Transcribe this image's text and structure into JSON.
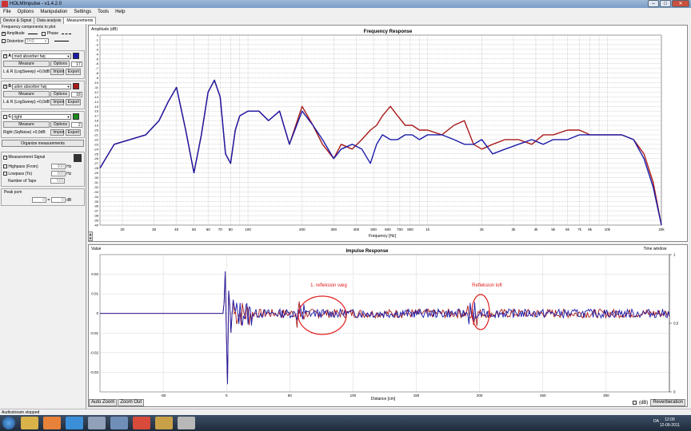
{
  "window": {
    "title": "HOLMImpulse - v1.4.2.0"
  },
  "menu": [
    "File",
    "Options",
    "Manipulation",
    "Settings",
    "Tools",
    "Help"
  ],
  "tabs": [
    {
      "label": "Device & Signal",
      "active": false
    },
    {
      "label": "Data analysis",
      "active": false
    },
    {
      "label": "Measurements",
      "active": true
    }
  ],
  "left": {
    "freq_components_label": "Frequency components to plot",
    "amplitude_label": "Amplitude",
    "phase_label": "Phase",
    "distortion_label": "Distortion",
    "distortion_value": "THD",
    "measurements": [
      {
        "letter": "A",
        "checked": true,
        "name": "med absorber høj",
        "color": "#1a1aa8",
        "measure_label": "Measure",
        "options_label": "Options",
        "spin": "17",
        "source": "L & R (LogSweep) +0,0dB",
        "import_label": "Import",
        "export_label": "Export"
      },
      {
        "letter": "B",
        "checked": true,
        "name": "uden absorber høj",
        "color": "#a81a1a",
        "measure_label": "Measure",
        "options_label": "Options",
        "spin": "18",
        "source": "L & R (LogSweep) +0,0dB",
        "import_label": "Import",
        "export_label": "Export"
      },
      {
        "letter": "C",
        "checked": false,
        "name": "right",
        "color": "#1a8a1a",
        "measure_label": "Measure",
        "options_label": "Options",
        "spin": "2",
        "source": "Right (SqNoise) +0,0dB",
        "import_label": "Import",
        "export_label": "Export"
      }
    ],
    "organize_label": "Organize measurements",
    "measurement_signal_label": "Measurement Signal",
    "highpass_label": "Highpass (From)",
    "highpass_value": "300",
    "lowpass_label": "Lowpass (To)",
    "lowpass_value": "500",
    "taps_label": "Number of Taps",
    "taps_value": "501",
    "hz": "Hz",
    "peak_label": "Peak pcm",
    "peak_db": "dB",
    "peak_sep": "=",
    "peak_value1": "0",
    "peak_value2": "0"
  },
  "chart_data": [
    {
      "type": "line",
      "title": "Frequency Response",
      "ylabel": "Amplitude (dB)",
      "xlabel": "Frequency [Hz]",
      "xscale": "log",
      "xlim": [
        15,
        20000
      ],
      "ylim": [
        -40,
        0
      ],
      "xticks": [
        20,
        30,
        40,
        50,
        60,
        70,
        80,
        100,
        200,
        300,
        400,
        500,
        600,
        700,
        800,
        "1k",
        "2k",
        "3k",
        "4k",
        "5k",
        "6k",
        "7k",
        "8k",
        "10k",
        "20k"
      ],
      "yticks": [
        0,
        -1,
        -2,
        -3,
        -4,
        -5,
        -6,
        -7,
        -8,
        -9,
        -10,
        -11,
        -12,
        -13,
        -14,
        -15,
        -16,
        -17,
        -18,
        -19,
        -20,
        -21,
        -22,
        -23,
        -24,
        -25,
        -26,
        -27,
        -28,
        -29,
        -30,
        -31,
        -32,
        -33,
        -34,
        -35,
        -36,
        -37,
        -38,
        -39,
        -40
      ],
      "series": [
        {
          "name": "med absorber høj",
          "color": "#1a1aa8",
          "x": [
            15,
            18,
            22,
            27,
            32,
            36,
            40,
            45,
            50,
            55,
            60,
            65,
            70,
            75,
            80,
            85,
            90,
            100,
            115,
            130,
            150,
            170,
            200,
            230,
            260,
            300,
            330,
            380,
            430,
            480,
            520,
            560,
            620,
            680,
            750,
            820,
            900,
            1000,
            1200,
            1400,
            1600,
            1800,
            2000,
            2300,
            2700,
            3200,
            3800,
            4400,
            5000,
            6000,
            7000,
            8000,
            9000,
            10000,
            12000,
            14000,
            16000,
            18000,
            20000
          ],
          "y": [
            -28,
            -23,
            -22,
            -21,
            -18,
            -14,
            -11,
            -20,
            -29,
            -21,
            -12,
            -9.5,
            -13,
            -25,
            -27,
            -20,
            -17,
            -16,
            -16,
            -18,
            -16,
            -23,
            -16,
            -19,
            -22,
            -26,
            -24,
            -23,
            -24,
            -27,
            -23,
            -21,
            -22,
            -22,
            -21,
            -21,
            -22,
            -21,
            -21,
            -22,
            -23,
            -23,
            -22,
            -25,
            -24,
            -23,
            -22,
            -23,
            -22,
            -22,
            -21,
            -21,
            -21,
            -21,
            -21,
            -22,
            -26,
            -32,
            -40
          ]
        },
        {
          "name": "uden absorber høj",
          "color": "#a81a1a",
          "x": [
            15,
            18,
            22,
            27,
            32,
            36,
            40,
            45,
            50,
            55,
            60,
            65,
            70,
            75,
            80,
            85,
            90,
            100,
            115,
            130,
            150,
            170,
            200,
            230,
            260,
            300,
            330,
            380,
            430,
            480,
            520,
            560,
            620,
            680,
            750,
            820,
            900,
            1000,
            1200,
            1400,
            1600,
            1800,
            2000,
            2300,
            2700,
            3200,
            3800,
            4400,
            5000,
            6000,
            7000,
            8000,
            9000,
            10000,
            12000,
            14000,
            16000,
            18000,
            20000
          ],
          "y": [
            -28,
            -23,
            -22,
            -21,
            -18,
            -14,
            -11,
            -20,
            -29,
            -21,
            -12,
            -9.5,
            -13,
            -25,
            -27,
            -20,
            -17,
            -16,
            -16,
            -18,
            -16,
            -23,
            -15,
            -19,
            -23,
            -26,
            -23,
            -24,
            -22,
            -20,
            -19,
            -17,
            -15,
            -17,
            -19,
            -19,
            -20,
            -20,
            -21,
            -19,
            -18,
            -23,
            -24,
            -23,
            -22,
            -22,
            -23,
            -21,
            -21,
            -20,
            -20,
            -21,
            -21,
            -21,
            -21,
            -22,
            -25,
            -31,
            -40
          ]
        }
      ]
    },
    {
      "type": "line",
      "title": "Impulse Response",
      "ylabel": "Value",
      "xlabel": "Distance [cm]",
      "xlim": [
        -100,
        350
      ],
      "ylim": [
        -0.04,
        0.03
      ],
      "xticks": [
        -50,
        0,
        50,
        100,
        150,
        200,
        250,
        300
      ],
      "yticks": [
        0.02,
        0.01,
        0,
        -0.01,
        -0.02,
        -0.03
      ],
      "right_axis_label": "Time window",
      "right_ticks": [
        "1",
        "0,5",
        "0"
      ],
      "annotations": [
        "1. refleksion væg",
        "Refleksion loft"
      ],
      "series": [
        {
          "name": "med absorber høj",
          "color": "#1a1aa8"
        },
        {
          "name": "uden absorber høj",
          "color": "#a81a1a"
        }
      ]
    }
  ],
  "impulse_buttons": {
    "autozoom": "Auto Zoom",
    "zoomout": "Zoom Out",
    "db_label": "(dB)",
    "reverb": "Reverberation"
  },
  "status": "Audiostream stopped",
  "clock": {
    "time": "12:09",
    "date": "12-09-2011"
  },
  "tray": {
    "lang": "DA"
  }
}
